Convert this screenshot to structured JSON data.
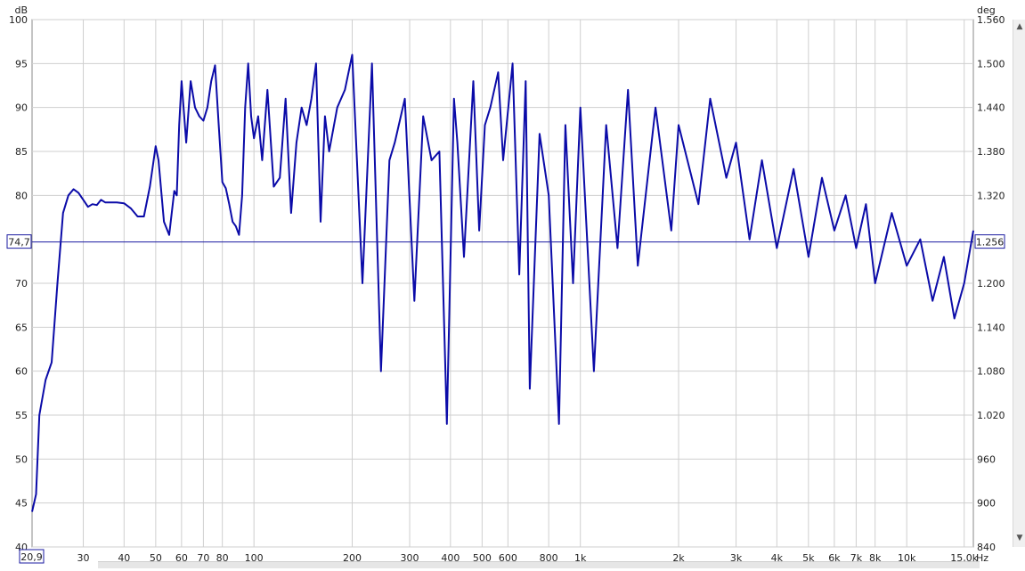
{
  "chart_data": {
    "type": "line",
    "title": "",
    "xlabel": "Hz",
    "ylabel": "dB",
    "y2label": "deg",
    "xscale": "log",
    "xlim": [
      20.9,
      16000
    ],
    "ylim": [
      40,
      100
    ],
    "y2lim": [
      840,
      1560
    ],
    "grid": true,
    "x_ticks": [
      {
        "v": 30,
        "label": "30"
      },
      {
        "v": 40,
        "label": "40"
      },
      {
        "v": 50,
        "label": "50"
      },
      {
        "v": 60,
        "label": "60"
      },
      {
        "v": 70,
        "label": "70"
      },
      {
        "v": 80,
        "label": "80"
      },
      {
        "v": 100,
        "label": "100"
      },
      {
        "v": 200,
        "label": "200"
      },
      {
        "v": 300,
        "label": "300"
      },
      {
        "v": 400,
        "label": "400"
      },
      {
        "v": 500,
        "label": "500"
      },
      {
        "v": 600,
        "label": "600"
      },
      {
        "v": 800,
        "label": "800"
      },
      {
        "v": 1000,
        "label": "1k"
      },
      {
        "v": 2000,
        "label": "2k"
      },
      {
        "v": 3000,
        "label": "3k"
      },
      {
        "v": 4000,
        "label": "4k"
      },
      {
        "v": 5000,
        "label": "5k"
      },
      {
        "v": 6000,
        "label": "6k"
      },
      {
        "v": 7000,
        "label": "7k"
      },
      {
        "v": 8000,
        "label": "8k"
      },
      {
        "v": 10000,
        "label": "10k"
      },
      {
        "v": 15000,
        "label": "15,0k"
      }
    ],
    "y_ticks": [
      {
        "v": 100,
        "label": "100"
      },
      {
        "v": 95,
        "label": "95"
      },
      {
        "v": 90,
        "label": "90"
      },
      {
        "v": 85,
        "label": "85"
      },
      {
        "v": 80,
        "label": "80"
      },
      {
        "v": 70,
        "label": "70"
      },
      {
        "v": 65,
        "label": "65"
      },
      {
        "v": 60,
        "label": "60"
      },
      {
        "v": 55,
        "label": "55"
      },
      {
        "v": 50,
        "label": "50"
      },
      {
        "v": 45,
        "label": "45"
      },
      {
        "v": 40,
        "label": "40"
      }
    ],
    "y2_ticks": [
      {
        "v": 1560,
        "label": "1.560"
      },
      {
        "v": 1500,
        "label": "1.500"
      },
      {
        "v": 1440,
        "label": "1.440"
      },
      {
        "v": 1380,
        "label": "1.380"
      },
      {
        "v": 1320,
        "label": "1.320"
      },
      {
        "v": 1200,
        "label": "1.200"
      },
      {
        "v": 1140,
        "label": "1.140"
      },
      {
        "v": 1080,
        "label": "1.080"
      },
      {
        "v": 1020,
        "label": "1.020"
      },
      {
        "v": 960,
        "label": "960"
      },
      {
        "v": 900,
        "label": "900"
      },
      {
        "v": 840,
        "label": "840"
      }
    ],
    "cursor": {
      "y": 74.7,
      "left_label": "74,7",
      "right_label": "1.256",
      "x_label": "20,9"
    },
    "series": [
      {
        "color": "#0b0ba8",
        "x": [
          20.9,
          21.5,
          22,
          23,
          24,
          25,
          26,
          27,
          28,
          29,
          30,
          31,
          32,
          33,
          34,
          35,
          36,
          38,
          40,
          42,
          44,
          46,
          48,
          50,
          51,
          53,
          55,
          57,
          58,
          59,
          60,
          62,
          64,
          66,
          68,
          70,
          72,
          74,
          76,
          78,
          80,
          82,
          84,
          86,
          88,
          90,
          92,
          94,
          96,
          98,
          100,
          103,
          106,
          110,
          115,
          120,
          125,
          130,
          135,
          140,
          145,
          150,
          155,
          160,
          165,
          170,
          180,
          190,
          200,
          215,
          230,
          245,
          260,
          270,
          290,
          310,
          330,
          350,
          370,
          390,
          410,
          420,
          440,
          470,
          490,
          510,
          530,
          560,
          580,
          620,
          650,
          680,
          700,
          750,
          800,
          860,
          900,
          950,
          1000,
          1100,
          1200,
          1300,
          1400,
          1500,
          1700,
          1900,
          2000,
          2300,
          2500,
          2800,
          3000,
          3300,
          3600,
          4000,
          4500,
          5000,
          5500,
          6000,
          6500,
          7000,
          7500,
          8000,
          9000,
          10000,
          11000,
          12000,
          13000,
          14000,
          15000,
          16000
        ],
        "values": [
          44,
          46,
          55,
          59,
          61,
          70,
          78,
          80,
          80.7,
          80.3,
          79.5,
          78.7,
          79,
          78.9,
          79.5,
          79.2,
          79.2,
          79.2,
          79.1,
          78.5,
          77.6,
          77.6,
          81,
          85.6,
          84,
          77,
          75.5,
          80.5,
          80,
          88,
          93,
          86,
          93,
          90,
          89,
          88.5,
          90,
          93,
          94.8,
          88,
          81.5,
          80.8,
          79,
          77,
          76.5,
          75.5,
          80,
          90,
          95,
          89,
          86.5,
          89,
          84,
          92,
          81,
          82,
          91,
          78,
          86,
          90,
          88,
          91,
          95,
          77,
          89,
          85,
          90,
          92,
          96,
          70,
          95,
          60,
          84,
          86,
          91,
          68,
          89,
          84,
          85,
          54,
          91,
          86,
          73,
          93,
          76,
          88,
          90,
          94,
          84,
          95,
          71,
          93,
          58,
          87,
          80,
          54,
          88,
          70,
          90,
          60,
          88,
          74,
          92,
          72,
          90,
          76,
          88,
          79,
          91,
          82,
          86,
          75,
          84,
          74,
          83,
          73,
          82,
          76,
          80,
          74,
          79,
          70,
          78,
          72,
          75,
          68,
          73,
          66,
          70,
          76
        ]
      }
    ]
  }
}
